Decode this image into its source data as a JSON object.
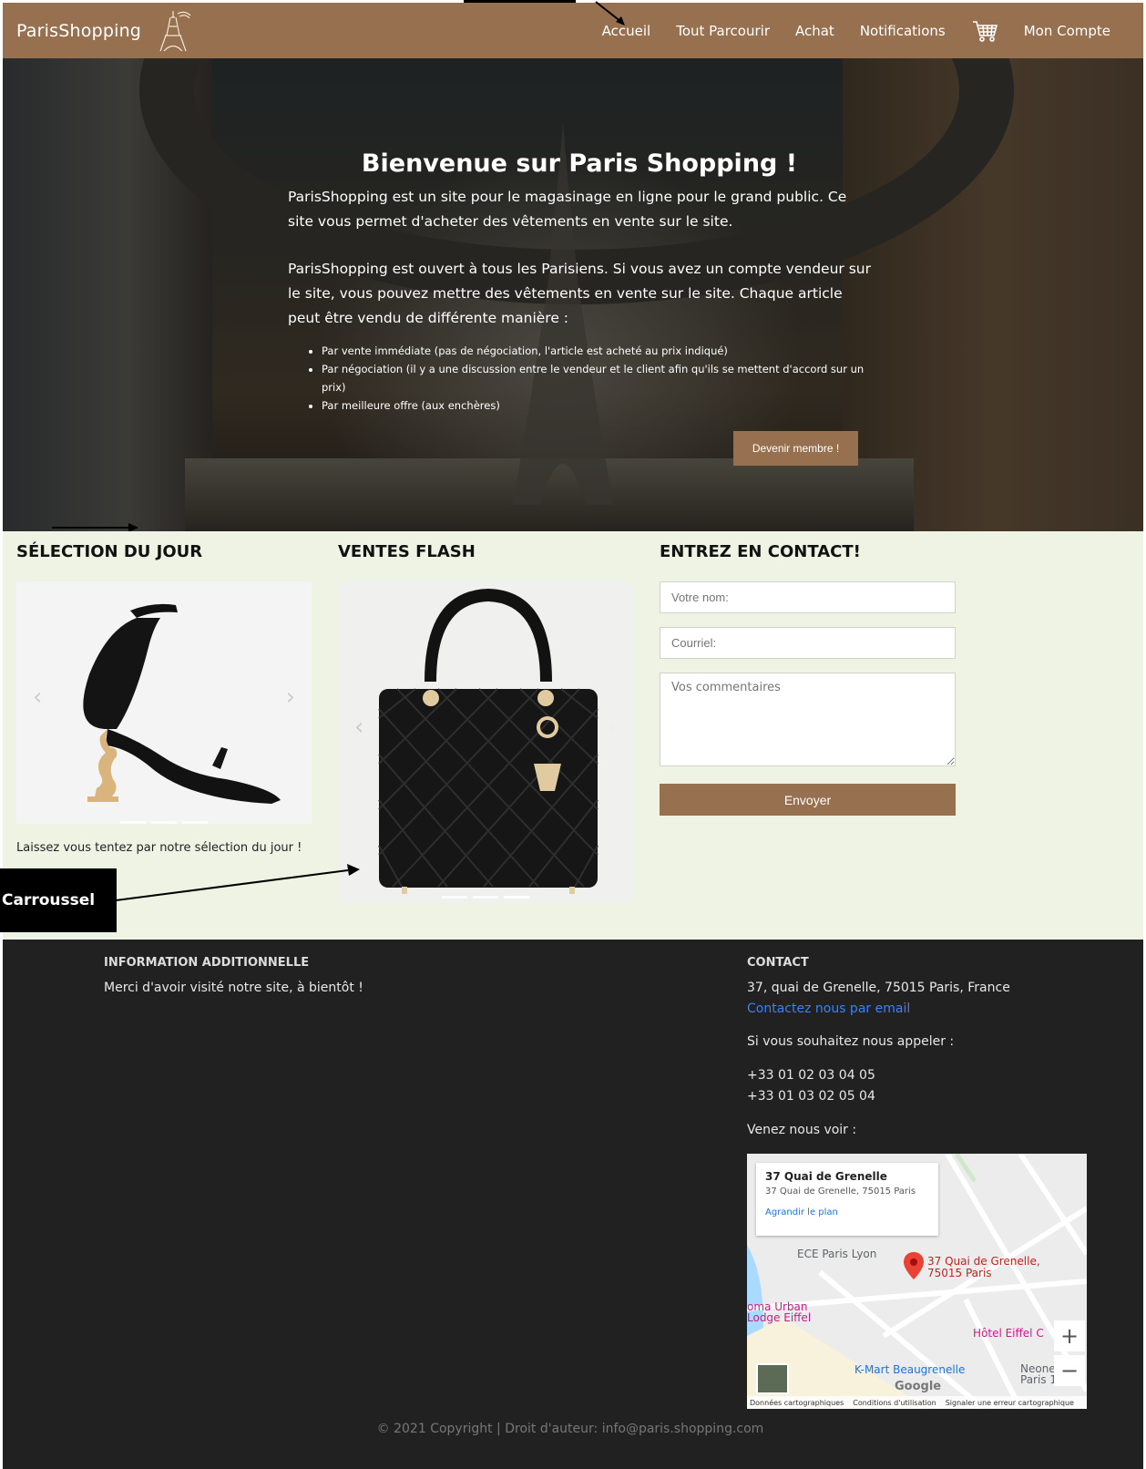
{
  "nav": {
    "brand": "ParisShopping",
    "links": [
      "Accueil",
      "Tout Parcourir",
      "Achat",
      "Notifications",
      "Mon Compte"
    ]
  },
  "hero": {
    "title": "Bienvenue sur Paris Shopping !",
    "p1": "ParisShopping est un site pour le magasinage en ligne pour le grand public. Ce site vous permet d'acheter des vêtements en vente sur le site.",
    "p2": "ParisShopping est ouvert à tous les Parisiens. Si vous avez un compte vendeur sur le site, vous pouvez mettre des vêtements en vente sur le site. Chaque article peut être vendu de différente manière :",
    "bullets": [
      "Par vente immédiate (pas de négociation, l'article est acheté au prix indiqué)",
      "Par négociation (il y a une discussion entre le vendeur et le client afin qu'ils se mettent d'accord sur un prix)",
      "Par meilleure offre (aux enchères)"
    ],
    "join_label": "Devenir membre !"
  },
  "selection": {
    "title": "SÉLECTION DU JOUR",
    "caption": "Laissez vous tentez par notre sélection du jour !"
  },
  "flash": {
    "title": "VENTES FLASH"
  },
  "contact_form": {
    "title": "ENTREZ EN CONTACT!",
    "name_placeholder": "Votre nom:",
    "email_placeholder": "Courriel:",
    "comments_placeholder": "Vos commentaires",
    "send_label": "Envoyer"
  },
  "annotation": {
    "carousel_label": "Carroussel"
  },
  "footer": {
    "info_title": "INFORMATION ADDITIONNELLE",
    "info_text": "Merci d'avoir visité notre site, à bientôt !",
    "contact_title": "CONTACT",
    "address": "37, quai de Grenelle, 75015 Paris, France",
    "email_link": "Contactez nous par email",
    "call_text": "Si vous souhaitez nous appeler :",
    "phone1": "+33 01 02 03 04 05",
    "phone2": "+33 01 03 02 05 04",
    "visit_text": "Venez nous voir :",
    "copyright": "© 2021 Copyright | Droit d'auteur: info@paris.shopping.com"
  },
  "map": {
    "card_title": "37 Quai de Grenelle",
    "card_sub": "37 Quai de Grenelle, 75015 Paris",
    "card_link": "Agrandir le plan",
    "pin_label_1": "37 Quai de Grenelle,",
    "pin_label_2": "75015 Paris",
    "poi1": "ECE Paris Lyon",
    "poi2a": "oma Urban",
    "poi2b": "Lodge Eiffel",
    "poi3": "Hôtel Eiffel C",
    "poi4": "K-Mart Beaugrenelle",
    "poi5a": "Neone",
    "poi5b": "Paris 15",
    "google": "Google",
    "foot1": "Données cartographiques",
    "foot2": "Conditions d'utilisation",
    "foot3": "Signaler une erreur cartographique"
  }
}
